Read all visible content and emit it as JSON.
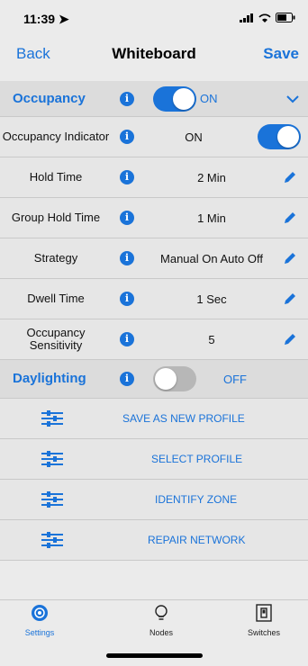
{
  "status": {
    "time": "11:39"
  },
  "nav": {
    "back": "Back",
    "title": "Whiteboard",
    "save": "Save"
  },
  "occupancy": {
    "label": "Occupancy",
    "state": "ON"
  },
  "rows": [
    {
      "label": "Occupancy Indicator",
      "value": "ON"
    },
    {
      "label": "Hold Time",
      "value": "2 Min"
    },
    {
      "label": "Group Hold Time",
      "value": "1 Min"
    },
    {
      "label": "Strategy",
      "value": "Manual On Auto Off"
    },
    {
      "label": "Dwell Time",
      "value": "1 Sec"
    },
    {
      "label": "Occupancy Sensitivity",
      "value": "5"
    }
  ],
  "daylighting": {
    "label": "Daylighting",
    "state": "OFF"
  },
  "actions": [
    {
      "label": "SAVE AS NEW PROFILE"
    },
    {
      "label": "SELECT PROFILE"
    },
    {
      "label": "IDENTIFY ZONE"
    },
    {
      "label": "REPAIR NETWORK"
    }
  ],
  "tabs": [
    {
      "label": "Settings",
      "icon": "gear-icon",
      "active": true
    },
    {
      "label": "Nodes",
      "icon": "bulb-icon",
      "active": false
    },
    {
      "label": "Switches",
      "icon": "switch-icon",
      "active": false
    }
  ],
  "colors": {
    "accent": "#1a73d9",
    "background": "#ebebeb",
    "toggle_off": "#b7b7b7"
  }
}
